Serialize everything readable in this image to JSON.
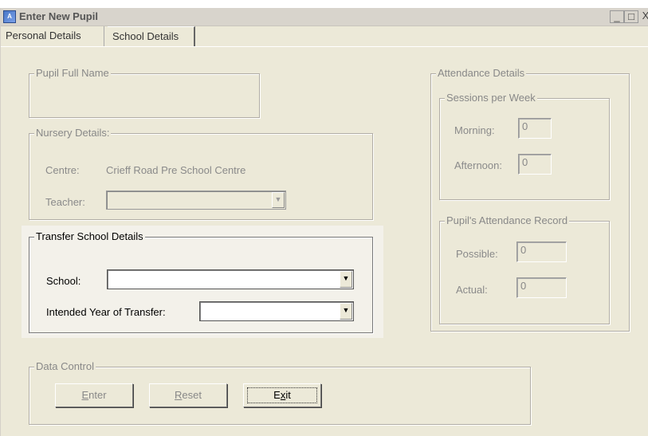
{
  "window": {
    "title": "Enter New Pupil",
    "icon": "app-icon",
    "controls": {
      "minimize": "_",
      "maximize": "□",
      "close": "X"
    }
  },
  "tabs": [
    {
      "label": "Personal Details",
      "selected": false
    },
    {
      "label": "School Details",
      "selected": true
    }
  ],
  "pupil": {
    "group_label": "Pupil Full Name",
    "full_name": ""
  },
  "nursery": {
    "group_label": "Nursery Details:",
    "centre_label": "Centre:",
    "centre_value": "Crieff Road Pre School Centre",
    "teacher_label": "Teacher:",
    "teacher_value": ""
  },
  "transfer": {
    "group_label": "Transfer School Details",
    "school_label": "School:",
    "school_value": "",
    "year_label": "Intended Year of Transfer:",
    "year_value": ""
  },
  "attendance": {
    "group_label": "Attendance Details",
    "sessions": {
      "group_label": "Sessions per Week",
      "morning_label": "Morning:",
      "morning_value": "0",
      "afternoon_label": "Afternoon:",
      "afternoon_value": "0"
    },
    "record": {
      "group_label": "Pupil's Attendance Record",
      "possible_label": "Possible:",
      "possible_value": "0",
      "actual_label": "Actual:",
      "actual_value": "0"
    }
  },
  "data_control": {
    "group_label": "Data Control",
    "enter": {
      "accel": "E",
      "rest": "nter"
    },
    "reset": {
      "accel": "R",
      "rest": "eset"
    },
    "exit": {
      "pre": "E",
      "accel": "x",
      "rest": "it"
    }
  }
}
